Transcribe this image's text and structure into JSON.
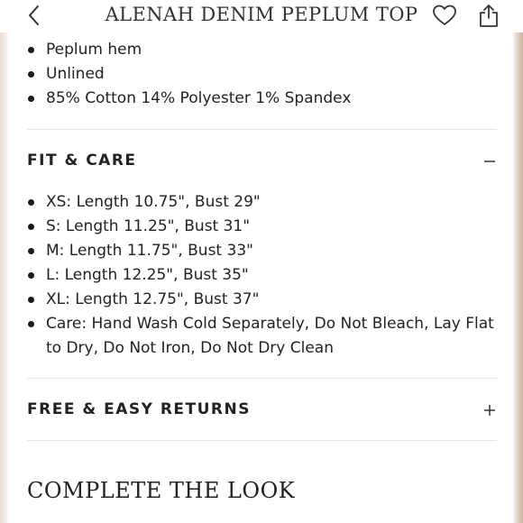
{
  "header": {
    "title": "ALENAH DENIM PEPLUM TOP",
    "back_icon": "chevron-left-icon",
    "favorite_icon": "heart-icon",
    "share_icon": "share-icon"
  },
  "details": {
    "items": [
      "Peplum hem",
      "Unlined",
      "85% Cotton 14% Polyester 1% Spandex"
    ]
  },
  "fit_care": {
    "title": "FIT & CARE",
    "toggle_icon": "minus-icon",
    "expanded": true,
    "items": [
      "XS: Length 10.75\", Bust 29\"",
      "S: Length 11.25\", Bust 31\"",
      "M: Length 11.75\", Bust 33\"",
      "L: Length 12.25\", Bust 35\"",
      "XL: Length 12.75\", Bust 37\"",
      "Care: Hand Wash Cold Separately, Do Not Bleach, Lay Flat to Dry, Do Not Iron, Do Not Dry Clean"
    ]
  },
  "returns": {
    "title": "FREE & EASY RETURNS",
    "toggle_icon": "plus-icon",
    "expanded": false
  },
  "complete_the_look": {
    "title": "COMPLETE THE LOOK"
  }
}
